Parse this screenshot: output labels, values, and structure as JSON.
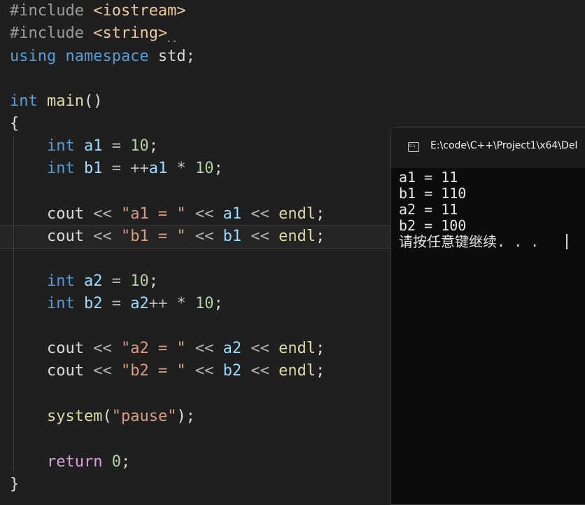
{
  "editor": {
    "lines": [
      {
        "id": "l1",
        "parts": [
          {
            "c": "pp",
            "t": "#include "
          },
          {
            "c": "inc",
            "t": "<iostream>"
          }
        ]
      },
      {
        "id": "l2",
        "parts": [
          {
            "c": "pp",
            "t": "#include "
          },
          {
            "c": "inc",
            "t": "<string>"
          }
        ]
      },
      {
        "id": "l3",
        "parts": [
          {
            "c": "kw",
            "t": "using namespace "
          },
          {
            "c": "",
            "t": "std;"
          }
        ]
      },
      {
        "id": "l4",
        "parts": []
      },
      {
        "id": "l5",
        "parts": [
          {
            "c": "kw",
            "t": "int "
          },
          {
            "c": "fn",
            "t": "main"
          },
          {
            "c": "",
            "t": "()"
          }
        ]
      },
      {
        "id": "l6",
        "parts": [
          {
            "c": "",
            "t": "{"
          }
        ]
      },
      {
        "id": "l7",
        "parts": [
          {
            "c": "",
            "t": "    "
          },
          {
            "c": "kw",
            "t": "int "
          },
          {
            "c": "var",
            "t": "a1"
          },
          {
            "c": "op",
            "t": " = "
          },
          {
            "c": "num",
            "t": "10"
          },
          {
            "c": "",
            "t": ";"
          }
        ]
      },
      {
        "id": "l8",
        "parts": [
          {
            "c": "",
            "t": "    "
          },
          {
            "c": "kw",
            "t": "int "
          },
          {
            "c": "var",
            "t": "b1"
          },
          {
            "c": "op",
            "t": " = ++"
          },
          {
            "c": "var",
            "t": "a1"
          },
          {
            "c": "op",
            "t": " * "
          },
          {
            "c": "num",
            "t": "10"
          },
          {
            "c": "",
            "t": ";"
          }
        ]
      },
      {
        "id": "l9",
        "parts": []
      },
      {
        "id": "l10",
        "parts": [
          {
            "c": "",
            "t": "    "
          },
          {
            "c": "",
            "t": "cout"
          },
          {
            "c": "op",
            "t": " << "
          },
          {
            "c": "str",
            "t": "\"a1 = \""
          },
          {
            "c": "op",
            "t": " << "
          },
          {
            "c": "var",
            "t": "a1"
          },
          {
            "c": "op",
            "t": " << "
          },
          {
            "c": "fn",
            "t": "endl"
          },
          {
            "c": "",
            "t": ";"
          }
        ]
      },
      {
        "id": "l11",
        "parts": [
          {
            "c": "",
            "t": "    "
          },
          {
            "c": "",
            "t": "cout"
          },
          {
            "c": "op",
            "t": " << "
          },
          {
            "c": "str",
            "t": "\"b1 = \""
          },
          {
            "c": "op",
            "t": " << "
          },
          {
            "c": "var",
            "t": "b1"
          },
          {
            "c": "op",
            "t": " << "
          },
          {
            "c": "fn",
            "t": "endl"
          },
          {
            "c": "",
            "t": ";"
          }
        ]
      },
      {
        "id": "l12",
        "parts": []
      },
      {
        "id": "l13",
        "parts": [
          {
            "c": "",
            "t": "    "
          },
          {
            "c": "kw",
            "t": "int "
          },
          {
            "c": "var",
            "t": "a2"
          },
          {
            "c": "op",
            "t": " = "
          },
          {
            "c": "num",
            "t": "10"
          },
          {
            "c": "",
            "t": ";"
          }
        ]
      },
      {
        "id": "l14",
        "parts": [
          {
            "c": "",
            "t": "    "
          },
          {
            "c": "kw",
            "t": "int "
          },
          {
            "c": "var",
            "t": "b2"
          },
          {
            "c": "op",
            "t": " = "
          },
          {
            "c": "var",
            "t": "a2"
          },
          {
            "c": "op",
            "t": "++ * "
          },
          {
            "c": "num",
            "t": "10"
          },
          {
            "c": "",
            "t": ";"
          }
        ]
      },
      {
        "id": "l15",
        "parts": []
      },
      {
        "id": "l16",
        "parts": [
          {
            "c": "",
            "t": "    "
          },
          {
            "c": "",
            "t": "cout"
          },
          {
            "c": "op",
            "t": " << "
          },
          {
            "c": "str",
            "t": "\"a2 = \""
          },
          {
            "c": "op",
            "t": " << "
          },
          {
            "c": "var",
            "t": "a2"
          },
          {
            "c": "op",
            "t": " << "
          },
          {
            "c": "fn",
            "t": "endl"
          },
          {
            "c": "",
            "t": ";"
          }
        ]
      },
      {
        "id": "l17",
        "parts": [
          {
            "c": "",
            "t": "    "
          },
          {
            "c": "",
            "t": "cout"
          },
          {
            "c": "op",
            "t": " << "
          },
          {
            "c": "str",
            "t": "\"b2 = \""
          },
          {
            "c": "op",
            "t": " << "
          },
          {
            "c": "var",
            "t": "b2"
          },
          {
            "c": "op",
            "t": " << "
          },
          {
            "c": "fn",
            "t": "endl"
          },
          {
            "c": "",
            "t": ";"
          }
        ]
      },
      {
        "id": "l18",
        "parts": []
      },
      {
        "id": "l19",
        "parts": [
          {
            "c": "",
            "t": "    "
          },
          {
            "c": "fn",
            "t": "system"
          },
          {
            "c": "",
            "t": "("
          },
          {
            "c": "str",
            "t": "\"pause\""
          },
          {
            "c": "",
            "t": ");"
          }
        ]
      },
      {
        "id": "l20",
        "parts": []
      },
      {
        "id": "l21",
        "parts": [
          {
            "c": "",
            "t": "    "
          },
          {
            "c": "ret",
            "t": "return "
          },
          {
            "c": "num",
            "t": "0"
          },
          {
            "c": "",
            "t": ";"
          }
        ]
      },
      {
        "id": "l22",
        "parts": [
          {
            "c": "",
            "t": "}"
          }
        ]
      }
    ],
    "include_hint": ".."
  },
  "console": {
    "title": "E:\\code\\C++\\Project1\\x64\\Del",
    "output": [
      "a1 = 11",
      "b1 = 110",
      "a2 = 11",
      "b2 = 100",
      "请按任意键继续. . ."
    ]
  },
  "icons": {
    "console_tab": "terminal-icon"
  }
}
